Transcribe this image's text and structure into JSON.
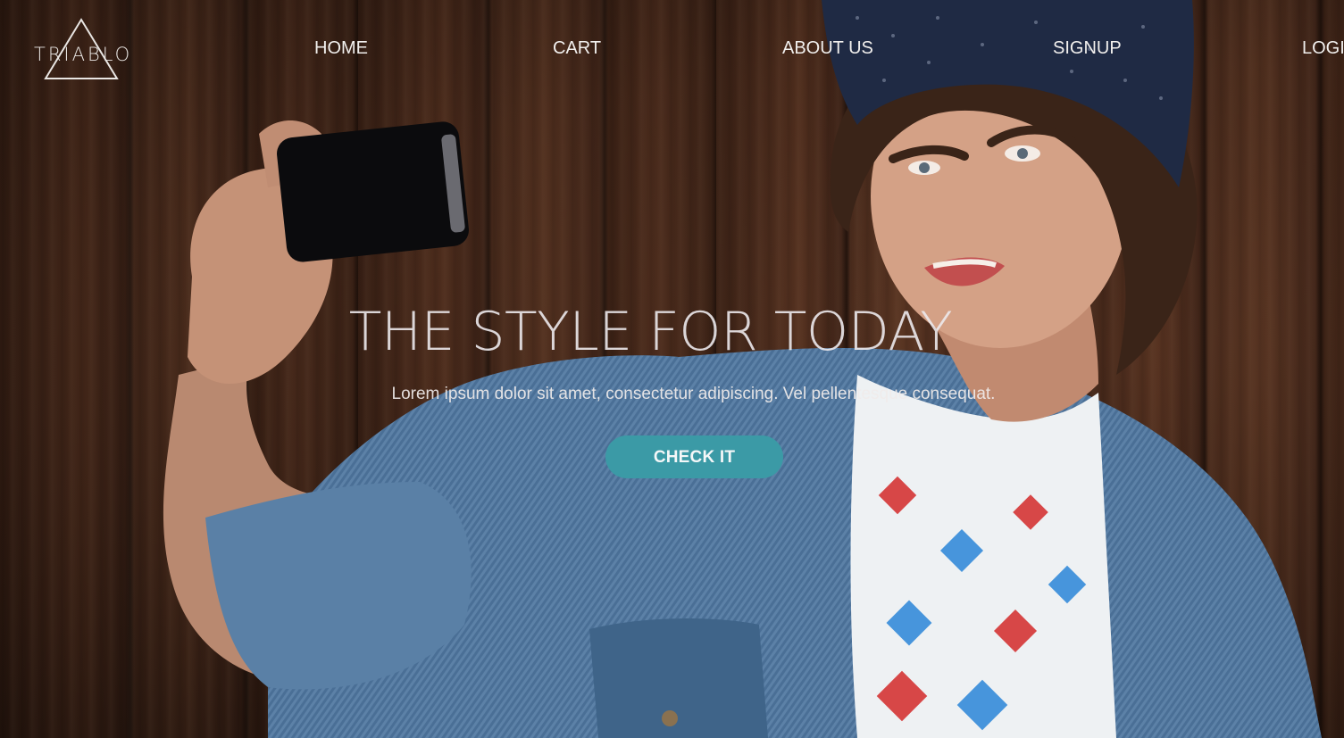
{
  "brand": {
    "name": "TRIABLO",
    "icon": "triangle-logo-icon"
  },
  "nav": {
    "items": [
      {
        "label": "HOME"
      },
      {
        "label": "CART"
      },
      {
        "label": "ABOUT US"
      },
      {
        "label": "SIGNUP"
      },
      {
        "label": "LOGI"
      }
    ]
  },
  "hero": {
    "title": "THE STYLE FOR TODAY",
    "subtitle": "Lorem ipsum dolor sit amet, consectetur adipiscing. Vel pellentesque consequat.",
    "cta_label": "CHECK IT",
    "background_image": "man-taking-selfie-photo"
  },
  "colors": {
    "accent": "#3b9aa6",
    "text": "#f1efed"
  }
}
